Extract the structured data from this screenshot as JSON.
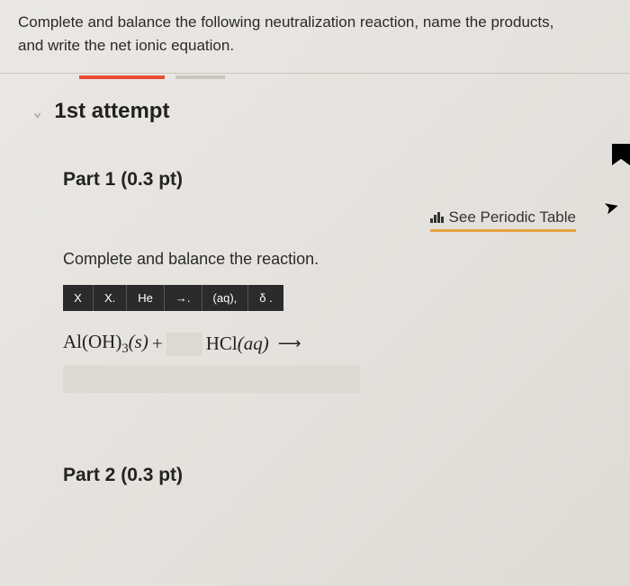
{
  "question": {
    "line1": "Complete and balance the following neutralization reaction, name the products,",
    "line2": "and write the net ionic equation."
  },
  "attempt_label": "1st attempt",
  "part1": {
    "label": "Part 1 (0.3 pt)",
    "instruction": "Complete and balance the reaction."
  },
  "periodic_link": "See Periodic Table",
  "toolbar": {
    "btn1": "X",
    "btn2": "X.",
    "btn3": "He",
    "btn4": "→.",
    "btn5": "(aq),",
    "btn6": "δ ."
  },
  "equation": {
    "r1_a": "Al(OH)",
    "r1_sub": "3",
    "r1_state": "(s)",
    "plus": " + ",
    "r2_a": "HCl",
    "r2_state": "(aq)",
    "arrow": "⟶"
  },
  "part2": {
    "label": "Part 2 (0.3 pt)"
  }
}
